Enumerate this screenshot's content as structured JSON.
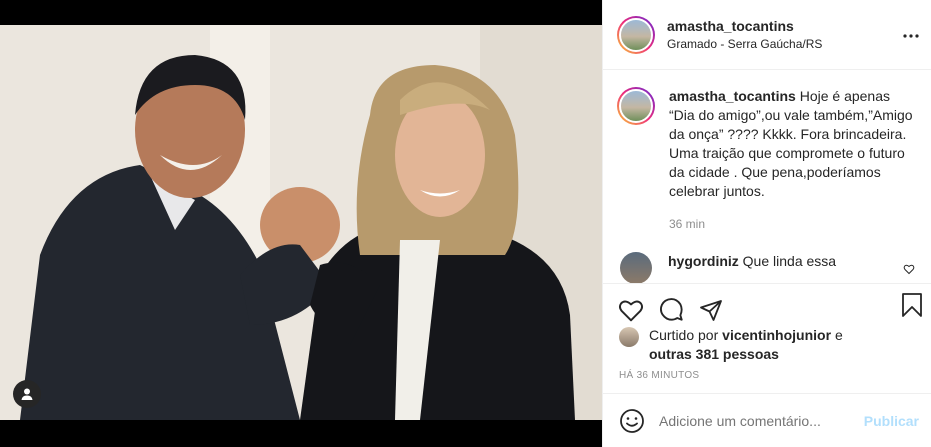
{
  "post": {
    "author": "amastha_tocantins",
    "location": "Gramado - Serra Gaúcha/RS",
    "more_icon": "more-horizontal-icon",
    "caption": {
      "username": "amastha_tocantins",
      "text": "Hoje é apenas “Dia do amigo”,ou vale também,”Amigo da onça” ???? Kkkk. Fora brincadeira. Uma traição que compromete o futuro da cidade . Que pena,poderíamos celebrar juntos.",
      "time": "36 min"
    },
    "comments": [
      {
        "username": "hygordiniz",
        "text": "Que linda essa"
      }
    ],
    "likes": {
      "prefix": "Curtido por",
      "user": "vicentinhojunior",
      "joiner": "e",
      "others": "outras 381 pessoas"
    },
    "time_ago": "HÁ 36 MINUTOS",
    "add_comment": {
      "placeholder": "Adicione um comentário...",
      "publish": "Publicar"
    }
  },
  "colors": {
    "accent_disabled": "#b2dffc",
    "muted_text": "#8e8e8e",
    "border": "#efefef"
  }
}
